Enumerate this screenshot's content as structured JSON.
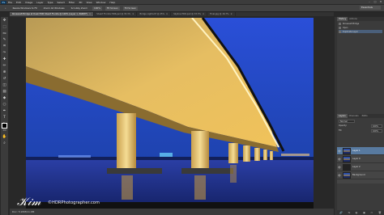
{
  "menubar": {
    "logo": "Ps",
    "items": [
      "File",
      "Edit",
      "Image",
      "Layer",
      "Type",
      "Select",
      "Filter",
      "3D",
      "View",
      "Window",
      "Help"
    ],
    "window_controls": [
      "–",
      "□",
      "✕"
    ]
  },
  "options_bar": {
    "items": [
      "Resize Windows to Fit",
      "Zoom All Windows",
      "Scrubby Zoom",
      "100%",
      "Fit Screen",
      "Fill Screen"
    ],
    "workspace": "Essentials"
  },
  "tabs": [
    {
      "label": "Roosevelt Bridge at Dusk HDR Stuart Florida @ 100% (Layer 1, RGB/8*)",
      "active": true
    },
    {
      "label": "Stuart Florida HDR.psd @ 33.3%",
      "active": false
    },
    {
      "label": "Bridge Lights.tif @ 25%",
      "active": false
    },
    {
      "label": "Skyline HDR.psd @ 33.3%",
      "active": false
    },
    {
      "label": "Final.jpg @ 16.7%",
      "active": false
    }
  ],
  "tools": [
    "move-icon",
    "marquee-icon",
    "lasso-icon",
    "quick-select-icon",
    "crop-icon",
    "eyedropper-icon",
    "healing-icon",
    "brush-icon",
    "clone-icon",
    "history-brush-icon",
    "eraser-icon",
    "gradient-icon",
    "blur-icon",
    "dodge-icon",
    "pen-icon",
    "type-icon",
    "path-select-icon",
    "shape-icon",
    "hand-icon",
    "zoom-icon"
  ],
  "tool_glyphs": [
    "✥",
    "⬚",
    "ᔓ",
    "✎",
    "⌗",
    "✑",
    "✚",
    "✏",
    "⊕",
    "↺",
    "◫",
    "▤",
    "◆",
    "○",
    "✒",
    "T",
    "➤",
    "▭",
    "✋",
    "⌕"
  ],
  "watermark": "©HDRPhotographer.com",
  "status": "Doc: 5.93M/11.9M",
  "history_panel": {
    "tabs": [
      "History",
      "Actions"
    ],
    "rows": [
      "Roosevelt Bridge",
      "Open",
      "Duplicate Layer"
    ]
  },
  "layers_panel": {
    "tabs": [
      "Layers",
      "Channels",
      "Paths"
    ],
    "blend_mode": "Normal",
    "opacity_label": "Opacity:",
    "opacity": "100%",
    "fill_label": "Fill:",
    "fill": "100%",
    "layers": [
      {
        "name": "Layer 1",
        "selected": true
      },
      {
        "name": "Layer 0",
        "selected": false
      },
      {
        "name": "Layer 2",
        "selected": false
      },
      {
        "name": "Background",
        "selected": false
      }
    ],
    "footer_icons": [
      "🔗",
      "fx",
      "◐",
      "▣",
      "▭",
      "🗑"
    ]
  },
  "colors": {
    "sky_top": "#2a4fd8",
    "sky_bottom": "#1a3fa0",
    "bridge_light": "#f0c25a",
    "water": "#1f2f8a"
  }
}
